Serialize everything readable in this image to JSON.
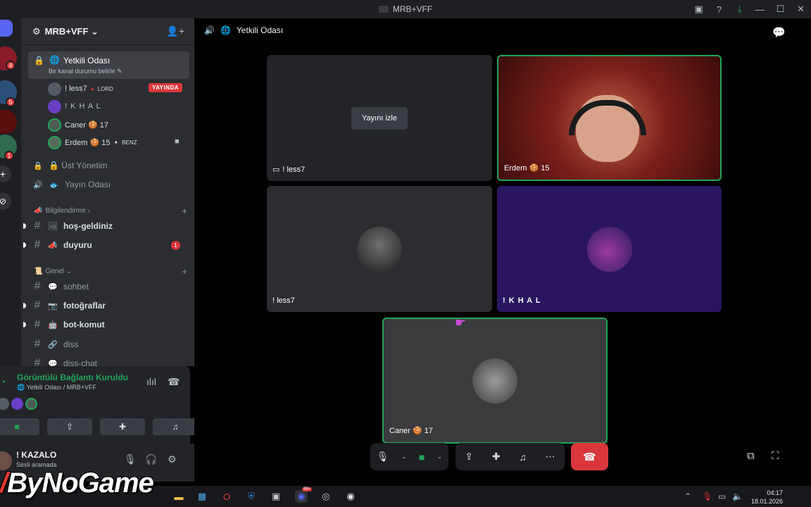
{
  "window": {
    "title": "MRB+VFF"
  },
  "server": {
    "name": "MRB+VFF ⌄"
  },
  "active_channel": {
    "name": "Yetkili Odası",
    "status": "Bir kanal durumu belirle ✎"
  },
  "members": [
    {
      "name": "! less7",
      "tag": "LORD",
      "live": "YAYINDA"
    },
    {
      "name": "! K H A L"
    },
    {
      "name": "Caner 🍪 17"
    },
    {
      "name": "Erdem 🍪 15",
      "tag": "BENZ"
    }
  ],
  "voice_channels": [
    {
      "name": "🔒 Üst Yönetim"
    },
    {
      "name": "Yayın Odası"
    }
  ],
  "categories": [
    {
      "name": "Bilgilendirme ›"
    },
    {
      "name": "Genel ⌄"
    }
  ],
  "text_channels_info": [
    {
      "name": "hoş-geldiniz",
      "emoji": "🖼"
    },
    {
      "name": "duyuru",
      "emoji": "📣",
      "unread": "1"
    }
  ],
  "text_channels_general": [
    {
      "name": "sohbet",
      "emoji": "💬"
    },
    {
      "name": "fotoğraflar",
      "emoji": "📷"
    },
    {
      "name": "bot-komut",
      "emoji": "🤖"
    },
    {
      "name": "diss",
      "emoji": "🔗"
    },
    {
      "name": "diss-chat",
      "emoji": "💬"
    }
  ],
  "rail_badges": [
    "4",
    "5",
    "1"
  ],
  "voice_panel": {
    "title": "Görüntülü Bağlantı Kuruldu",
    "subtitle": "Yetkili Odası / MRB+VFF"
  },
  "user": {
    "name": "! KAZALO",
    "status": "Sesli aramada"
  },
  "main_header": {
    "title": "Yetkili Odası"
  },
  "tiles": [
    {
      "label": "! less7",
      "button": "Yayını izle"
    },
    {
      "label": "Erdem 🍪 15"
    },
    {
      "label": "! less7"
    },
    {
      "label": "! K H A L"
    },
    {
      "label": "Caner 🍪 17"
    }
  ],
  "taskbar": {
    "time": "04:17",
    "date": "18.01.2026",
    "discord_badge": "99+"
  },
  "watermark": "ByNoGame",
  "colors": {
    "accent_green": "#23a55a",
    "danger": "#da373c",
    "bg_sidebar": "#2b2d31",
    "bg_tile": "#2b2d31",
    "khal_tile": "#2a1660"
  }
}
